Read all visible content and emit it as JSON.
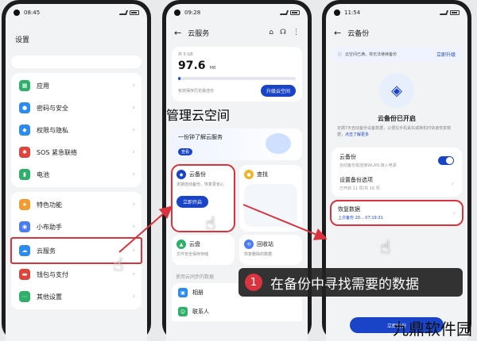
{
  "phone1": {
    "time": "08:45",
    "title": "设置",
    "items": [
      {
        "label": "应用",
        "color": "#2fb06a",
        "icon": "grid-icon"
      },
      {
        "label": "密码与安全",
        "color": "#2b8bf0",
        "icon": "lock-icon"
      },
      {
        "label": "权限与隐私",
        "color": "#2b8bf0",
        "icon": "shield-icon"
      },
      {
        "label": "SOS 紧急联络",
        "color": "#e0433a",
        "icon": "sos-icon"
      },
      {
        "label": "电池",
        "color": "#2fb06a",
        "icon": "battery-icon"
      },
      {
        "label": "特色功能",
        "color": "#f39b2e",
        "icon": "star-icon"
      },
      {
        "label": "小布助手",
        "color": "#4b7bf5",
        "icon": "assistant-icon"
      },
      {
        "label": "云服务",
        "color": "#2b8bf0",
        "icon": "cloud-icon"
      },
      {
        "label": "钱包与支付",
        "color": "#e0433a",
        "icon": "wallet-icon"
      },
      {
        "label": "其他设置",
        "color": "#2fb06a",
        "icon": "more-icon"
      }
    ]
  },
  "phone2": {
    "time": "09:28",
    "title": "云服务",
    "storage_label": "共 5 GB",
    "storage_value": "97.6",
    "storage_unit": "MB",
    "manage": "管理云空间",
    "storage_used_fraction": 0.02,
    "upgrade_hint": "有效保存历史最佳份",
    "upgrade_btn": "升级云空间",
    "promo_title": "一份钟了解云服务",
    "promo_tag": "查看",
    "tile_backup": {
      "title": "云备份",
      "desc": "定期自动备份，恢复更省心",
      "btn": "立即开启"
    },
    "tile_find": {
      "title": "查找"
    },
    "tile_disk": {
      "title": "云盘",
      "desc": "文件安全保存存储"
    },
    "tile_recycle": {
      "title": "回收站",
      "desc": "恢复删除的数据"
    },
    "section": "使用云同步的数据",
    "list": [
      {
        "label": "相册",
        "sub": "",
        "color": "#2b8bf0"
      },
      {
        "label": "联系人",
        "sub": "",
        "color": "#2fb06a"
      }
    ]
  },
  "phone3": {
    "time": "11:54",
    "title": "云备份",
    "notice": "云空间已满，将无法继续备份",
    "notice_action": "立即升级",
    "hero_title": "云备份已开启",
    "hero_desc": "定期7天自动备份设备数据，以便在手机丢失或换机时快速恢复数据，",
    "hero_link": "点击了解更多",
    "auto_backup": {
      "title": "云备份",
      "desc": "自动备份需连接WLAN,接入电源"
    },
    "backup_options": {
      "title": "设置备份选项",
      "desc": "已开启 11 项/共 16 项"
    },
    "restore": {
      "title": "恢复数据",
      "desc": "上次备份 20... 07:19:31"
    },
    "bottom_btn": "立即备份"
  },
  "callout": {
    "number": "1",
    "text": "在备份中寻找需要的数据"
  },
  "watermark": "九鼎软件园",
  "colors": {
    "accent": "#1a44c8",
    "highlight": "#d9333f"
  }
}
